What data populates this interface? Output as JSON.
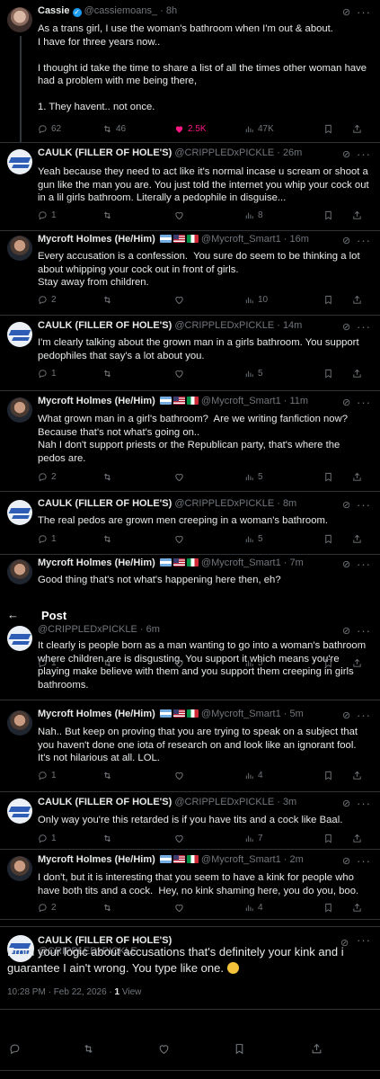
{
  "header": {
    "back_icon": "arrow-left-icon",
    "title": "Post"
  },
  "tweets": [
    {
      "name": "Cassie",
      "handle": "@cassiemoans_",
      "time": "· 8h",
      "text": "As a trans girl, I use the woman's bathroom when I'm out & about.\nI have for three years now..\n\nI thought id take the time to share a list of all the times other woman have had a problem with me being there,\n\n1. They havent.. not once.",
      "replies": "62",
      "reposts": "46",
      "likes": "2.5K",
      "views": "47K"
    },
    {
      "name": "CAULK (FILLER OF HOLE'S)",
      "handle": "@CRIPPLEDxPICKLE",
      "time": "· 26m",
      "text": "Yeah because they need to act like it's normal incase u scream or shoot a gun like the man you are. You just told the internet you whip your cock out in a lil girls bathroom. Literally a pedophile in disguise...",
      "replies": "1",
      "reposts": "",
      "likes": "",
      "views": "8"
    },
    {
      "name": "Mycroft Holmes (He/Him)",
      "handle": "@Mycroft_Smart1",
      "time": "· 16m",
      "text": "Every accusation is a confession.  You sure do seem to be thinking a lot about whipping your cock out in front of girls.\nStay away from children.",
      "replies": "2",
      "reposts": "",
      "likes": "",
      "views": "10"
    },
    {
      "name": "CAULK (FILLER OF HOLE'S)",
      "handle": "@CRIPPLEDxPICKLE",
      "time": "· 14m",
      "text": "I'm clearly talking about the grown man in a girls bathroom. You support pedophiles that say's a lot about you.",
      "replies": "1",
      "reposts": "",
      "likes": "",
      "views": "5"
    },
    {
      "name": "Mycroft Holmes (He/Him)",
      "handle": "@Mycroft_Smart1",
      "time": "· 11m",
      "text": "What grown man in a girl's bathroom?  Are we writing fanfiction now?  Because that's not what's going on..\nNah I don't support priests or the Republican party, that's where the pedos are.",
      "replies": "2",
      "reposts": "",
      "likes": "",
      "views": "5"
    },
    {
      "name": "CAULK (FILLER OF HOLE'S)",
      "handle": "@CRIPPLEDxPICKLE",
      "time": "· 8m",
      "text": "The real pedos are grown men creeping in a woman's bathroom.",
      "replies": "1",
      "reposts": "",
      "likes": "",
      "views": "5"
    },
    {
      "name": "Mycroft Holmes (He/Him)",
      "handle": "@Mycroft_Smart1",
      "time": "· 7m",
      "text": "Good thing that's not what's happening here then, eh?",
      "replies": "",
      "reposts": "",
      "likes": "",
      "views": ""
    },
    {
      "name": "",
      "handle": "@CRIPPLEDxPICKLE",
      "time": "· 6m",
      "text": "It clearly is people born as a man wanting to go into a woman's bathroom where children are is disgusting. You support it which means you're playing make believe with them and you support them creeping in girls bathrooms.",
      "replies": "1",
      "reposts": "",
      "likes": "",
      "views": "5"
    },
    {
      "name": "Mycroft Holmes (He/Him)",
      "handle": "@Mycroft_Smart1",
      "time": "· 5m",
      "text": "Nah.. But keep on proving that you are trying to speak on a subject that you haven't done one iota of research on and look like an ignorant fool.  It's not hilarious at all. LOL.",
      "replies": "1",
      "reposts": "",
      "likes": "",
      "views": "4"
    },
    {
      "name": "CAULK (FILLER OF HOLE'S)",
      "handle": "@CRIPPLEDxPICKLE",
      "time": "· 3m",
      "text": "Only way you're this retarded is if you have tits and a cock like Baal.",
      "replies": "1",
      "reposts": "",
      "likes": "",
      "views": "7"
    },
    {
      "name": "Mycroft Holmes (He/Him)",
      "handle": "@Mycroft_Smart1",
      "time": "· 2m",
      "text": "I don't, but it is interesting that you seem to have a kink for people who have both tits and a cock.  Hey, no kink shaming here, you do you, boo.",
      "replies": "2",
      "reposts": "",
      "likes": "",
      "views": "4"
    }
  ],
  "main": {
    "name": "CAULK (FILLER OF HOLE'S)",
    "handle": "@CRIPPLEDxPICKLE",
    "text": "From your logic about accusations that's definitely your kink and i guarantee I ain't wrong. You type like one.",
    "date": "10:28 PM · Feb 22, 2026 · ",
    "views_count": "1",
    "views_label": " View"
  },
  "colors": {
    "accent": "#1d9bf0",
    "like": "#f91880",
    "muted": "#71767b",
    "bg": "#000000"
  }
}
